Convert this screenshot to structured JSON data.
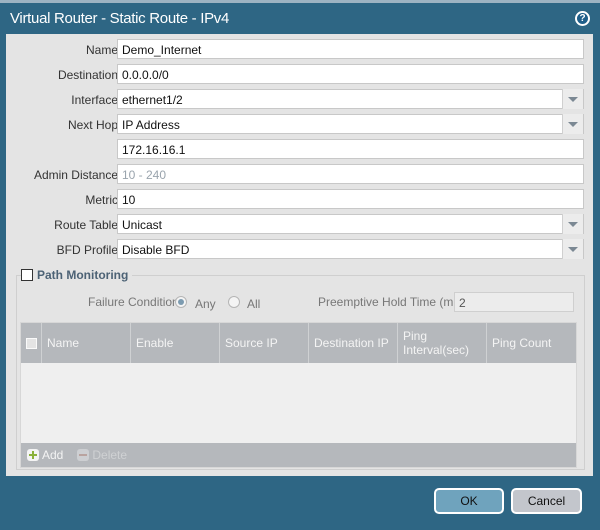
{
  "window": {
    "title": "Virtual Router - Static Route - IPv4",
    "help_icon": "question-circle-icon"
  },
  "form": {
    "fields": [
      {
        "label": "Name",
        "value": "Demo_Internet",
        "type": "text"
      },
      {
        "label": "Destination",
        "value": "0.0.0.0/0",
        "type": "text"
      },
      {
        "label": "Interface",
        "value": "ethernet1/2",
        "type": "select"
      },
      {
        "label": "Next Hop",
        "value": "IP Address",
        "type": "select"
      },
      {
        "label": "",
        "value": "172.16.16.1",
        "type": "text"
      },
      {
        "label": "Admin Distance",
        "value": "",
        "placeholder": "10 - 240",
        "type": "text"
      },
      {
        "label": "Metric",
        "value": "10",
        "type": "text"
      },
      {
        "label": "Route Table",
        "value": "Unicast",
        "type": "select"
      },
      {
        "label": "BFD Profile",
        "value": "Disable BFD",
        "type": "select"
      }
    ]
  },
  "path_monitoring": {
    "label": "Path Monitoring",
    "checked": false,
    "failure_condition_label": "Failure Condition",
    "options": [
      {
        "label": "Any",
        "selected": true
      },
      {
        "label": "All",
        "selected": false
      }
    ],
    "hold_time_label": "Preemptive Hold Time (min)",
    "hold_time_value": "2",
    "table": {
      "columns": [
        "Name",
        "Enable",
        "Source IP",
        "Destination IP",
        "Ping Interval(sec)",
        "Ping Count"
      ],
      "rows": []
    },
    "add_label": "Add",
    "delete_label": "Delete"
  },
  "buttons": {
    "ok": "OK",
    "cancel": "Cancel"
  }
}
